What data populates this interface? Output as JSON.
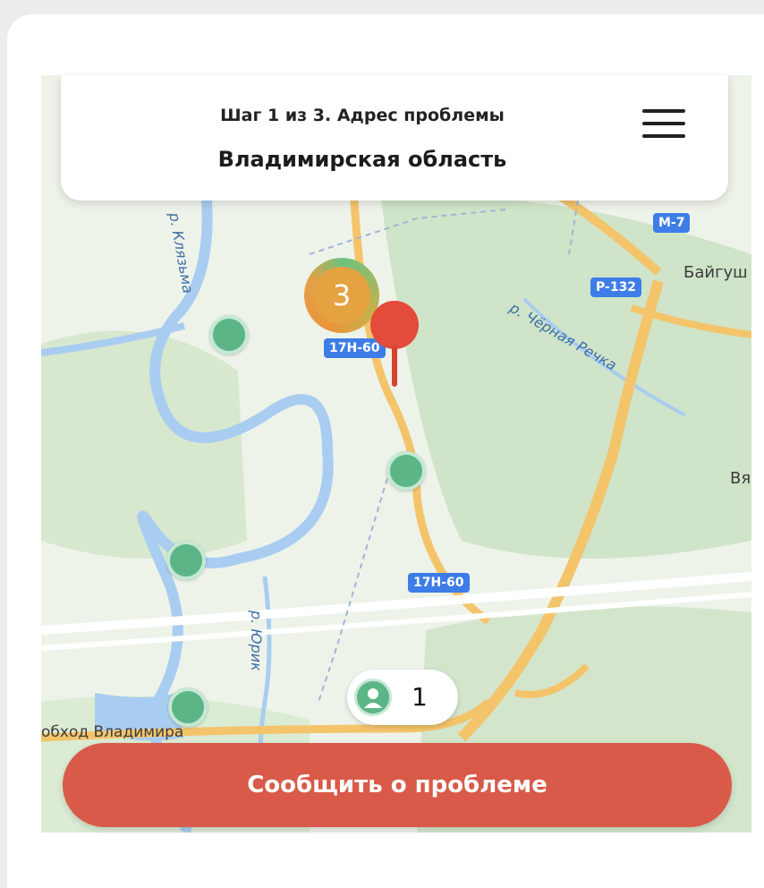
{
  "header": {
    "step": "Шаг 1 из 3. Адрес проблемы",
    "region": "Владимирская область"
  },
  "map": {
    "road_badges": [
      "M-7",
      "P-132",
      "17H-60",
      "17H-60"
    ],
    "place_labels": [
      "Байгуш",
      "Вя",
      "обход Владимира"
    ],
    "river_labels": [
      "р. Клязьма",
      "р. Чёрная Речка",
      "р. Юрик"
    ],
    "cluster_count": "3",
    "users_count": "1",
    "icons": [
      "menu-icon",
      "marker-pin-icon",
      "user-icon"
    ]
  },
  "actions": {
    "report_label": "Сообщить о проблеме"
  },
  "colors": {
    "accent": "#d95a48",
    "pin_green": "#5cb586",
    "pin_red": "#e34b3a",
    "road_badge": "#3e7de8"
  }
}
